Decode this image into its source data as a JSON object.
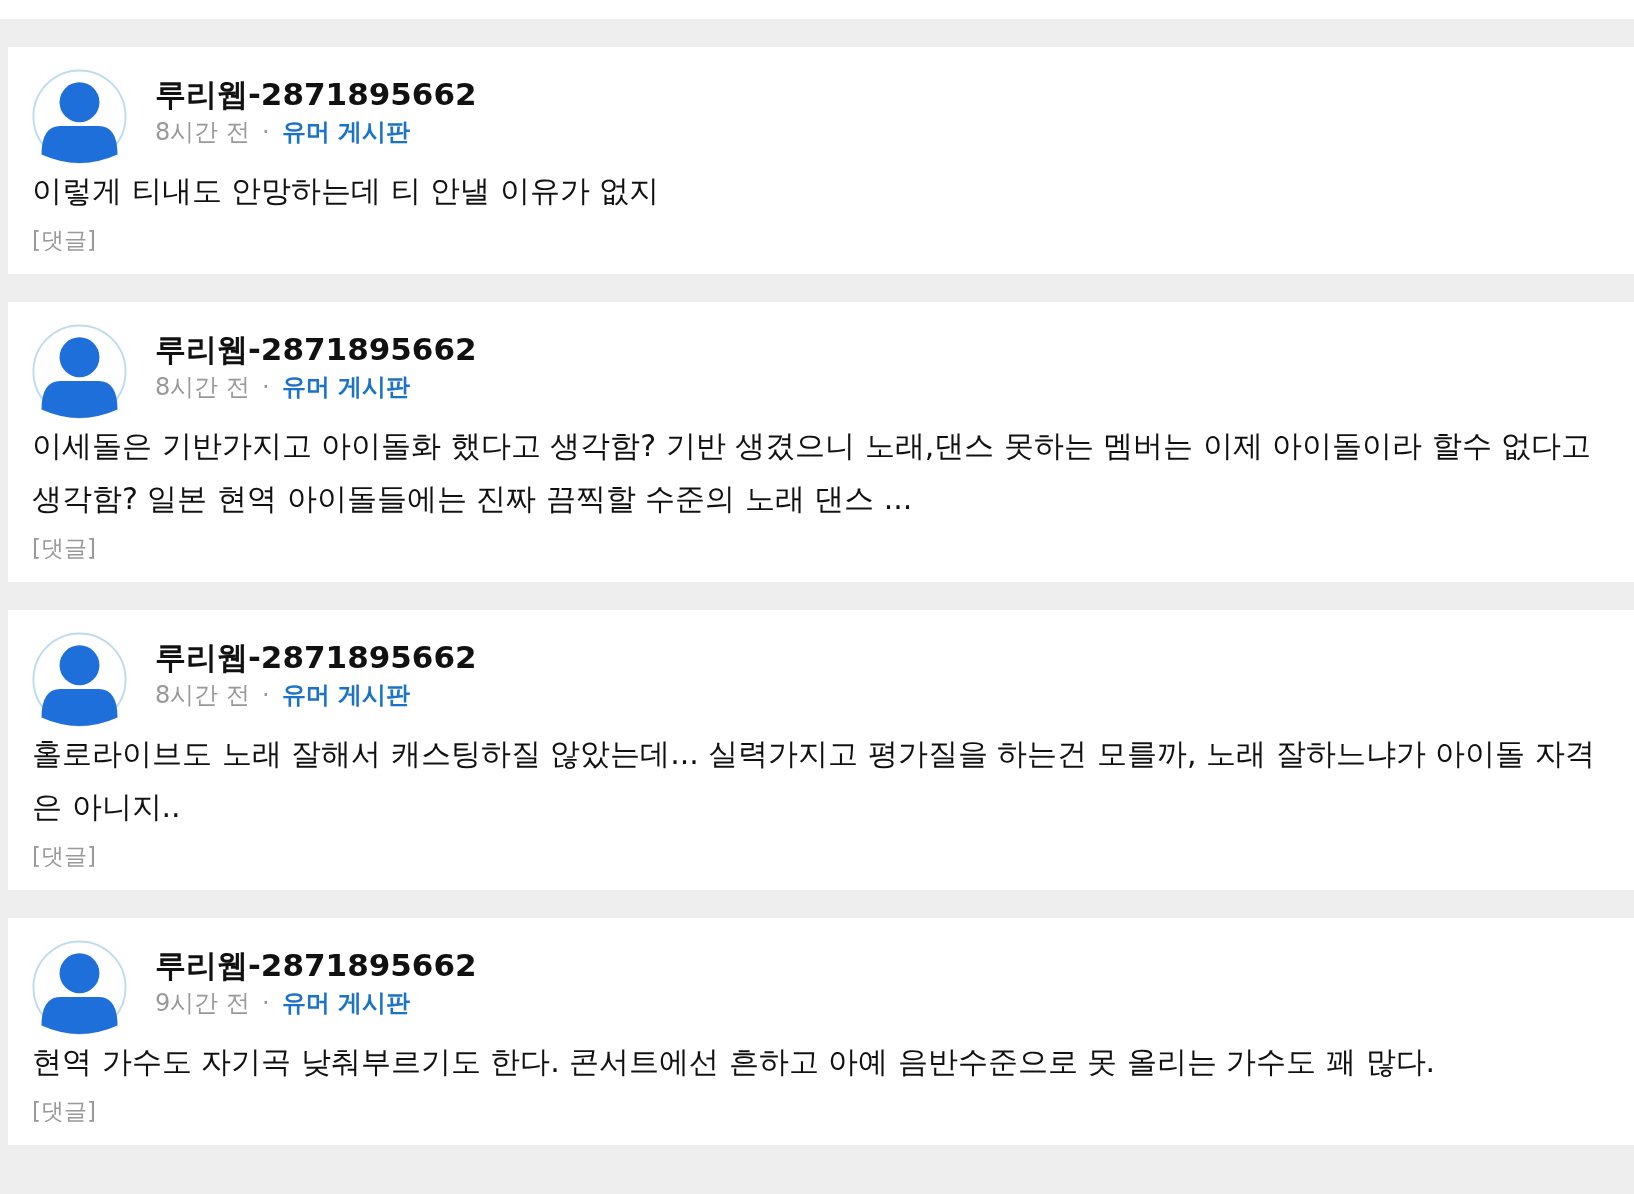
{
  "comments": [
    {
      "author": "루리웹-2871895662",
      "time": "8시간 전",
      "separator": "·",
      "board": "유머 게시판",
      "body": "이렇게 티내도 안망하는데 티 안낼 이유가 없지",
      "reply": "[댓글]"
    },
    {
      "author": "루리웹-2871895662",
      "time": "8시간 전",
      "separator": "·",
      "board": "유머 게시판",
      "body": "이세돌은 기반가지고 아이돌화 했다고 생각함? 기반 생겼으니 노래,댄스 못하는 멤버는 이제 아이돌이라 할수 없다고 생각함? 일본 현역 아이돌들에는 진짜 끔찍할 수준의 노래 댄스 ...",
      "reply": "[댓글]"
    },
    {
      "author": "루리웹-2871895662",
      "time": "8시간 전",
      "separator": "·",
      "board": "유머 게시판",
      "body": "홀로라이브도 노래 잘해서 캐스팅하질 않았는데... 실력가지고 평가질을 하는건 모를까, 노래 잘하느냐가 아이돌 자격은 아니지..",
      "reply": "[댓글]"
    },
    {
      "author": "루리웹-2871895662",
      "time": "9시간 전",
      "separator": "·",
      "board": "유머 게시판",
      "body": "현역 가수도 자기곡 낮춰부르기도 한다. 콘서트에선 흔하고 아예 음반수준으로 못 올리는 가수도 꽤 많다.",
      "reply": "[댓글]"
    }
  ]
}
